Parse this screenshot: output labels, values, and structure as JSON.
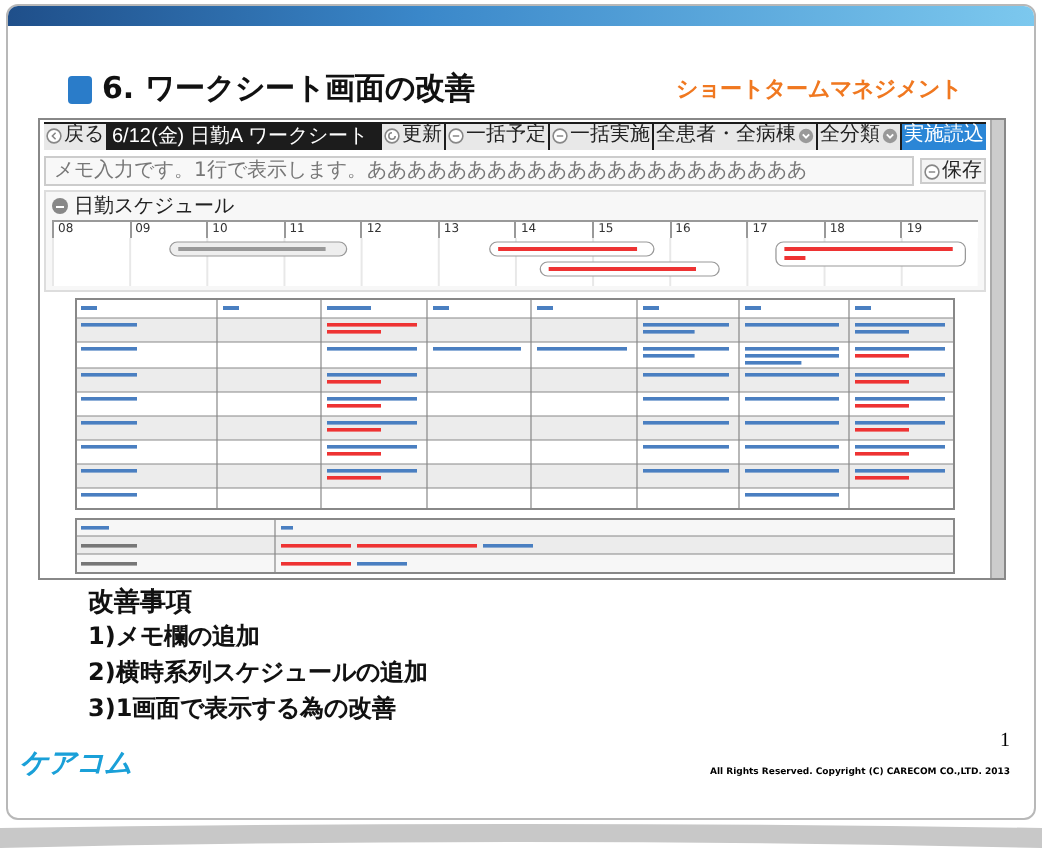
{
  "slide": {
    "title": "6. ワークシート画面の改善",
    "subtitle": "ショートタームマネジメント"
  },
  "worksheet": {
    "toolbar": {
      "back": "戻る",
      "title": "6/12(金) 日勤A ワークシート",
      "buttons": [
        {
          "label": "更新",
          "kind": "refresh"
        },
        {
          "label": "一括予定",
          "kind": "icon"
        },
        {
          "label": "一括実施",
          "kind": "icon"
        },
        {
          "label": "全患者・全病棟",
          "kind": "dropdown"
        },
        {
          "label": "全分類",
          "kind": "dropdown"
        },
        {
          "label": "実施読込",
          "kind": "primary"
        }
      ]
    },
    "memo": {
      "value": "メモ入力です。1行で表示します。ああああああああああああああああああああああ",
      "save": "保存"
    },
    "schedule": {
      "title": "日勤スケジュール",
      "expanded": true,
      "hours": [
        "08",
        "09",
        "10",
        "11",
        "12",
        "13",
        "14",
        "15",
        "16",
        "17",
        "18",
        "19"
      ]
    }
  },
  "notes": {
    "heading": "改善事項",
    "items": [
      "1)メモ欄の追加",
      "2)横時系列スケジュールの追加",
      "3)1画面で表示する為の改善"
    ]
  },
  "page_number": "1",
  "logo": "ケアコム",
  "copyright": "All Rights Reserved. Copyright (C) CARECOM CO.,LTD. 2013"
}
